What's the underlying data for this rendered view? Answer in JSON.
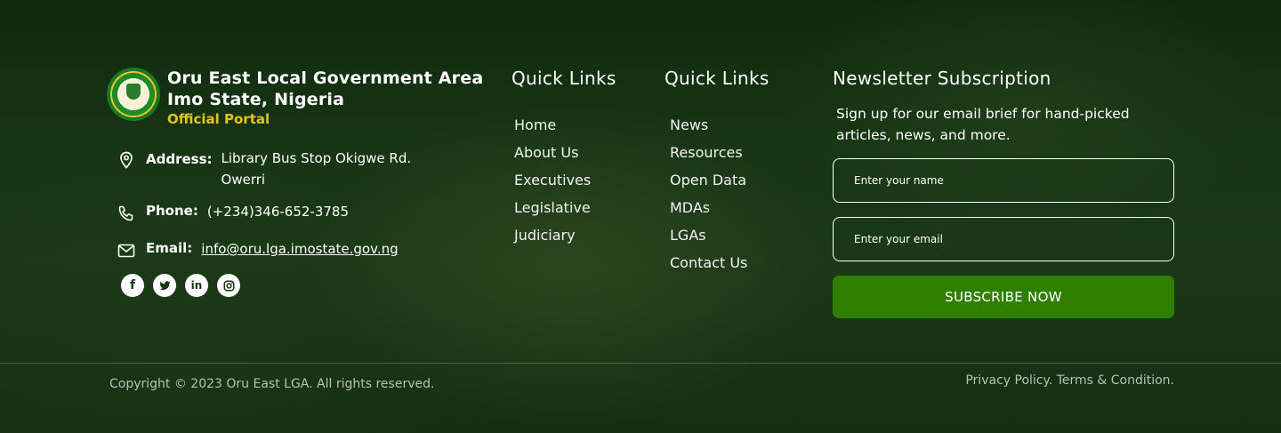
{
  "brand": {
    "title_line1": "Oru East Local Government Area",
    "title_line2": "Imo State, Nigeria",
    "portal": "Official Portal"
  },
  "contact": {
    "address_label": "Address:",
    "address_line1": "Library Bus Stop Okigwe Rd.",
    "address_line2": "Owerri",
    "phone_label": "Phone:",
    "phone_value": "(+234)346-652-3785",
    "email_label": "Email:",
    "email_value": "info@oru.lga.imostate.gov.ng"
  },
  "socials": [
    {
      "name": "facebook",
      "glyph": "f"
    },
    {
      "name": "twitter",
      "glyph": "t"
    },
    {
      "name": "linkedin",
      "glyph": "in"
    },
    {
      "name": "instagram",
      "glyph": "◎"
    }
  ],
  "quick_links_1": {
    "title": "Quick Links",
    "items": [
      "Home",
      "About Us",
      "Executives",
      "Legislative",
      "Judiciary"
    ]
  },
  "quick_links_2": {
    "title": "Quick Links",
    "items": [
      "News",
      "Resources",
      "Open Data",
      "MDAs",
      "LGAs",
      "Contact Us"
    ]
  },
  "newsletter": {
    "title": "Newsletter Subscription",
    "description": "Sign up for our email brief for hand-picked articles, news, and more.",
    "name_placeholder": "Enter your name",
    "email_placeholder": "Enter your email",
    "button_label": "SUBSCRIBE NOW"
  },
  "bottom": {
    "copyright": "Copyright © 2023 Oru East LGA. All rights reserved.",
    "privacy": "Privacy Policy.",
    "terms": "Terms & Condition."
  },
  "colors": {
    "accent_green": "#2f8000",
    "portal_yellow": "#e3c41b"
  }
}
